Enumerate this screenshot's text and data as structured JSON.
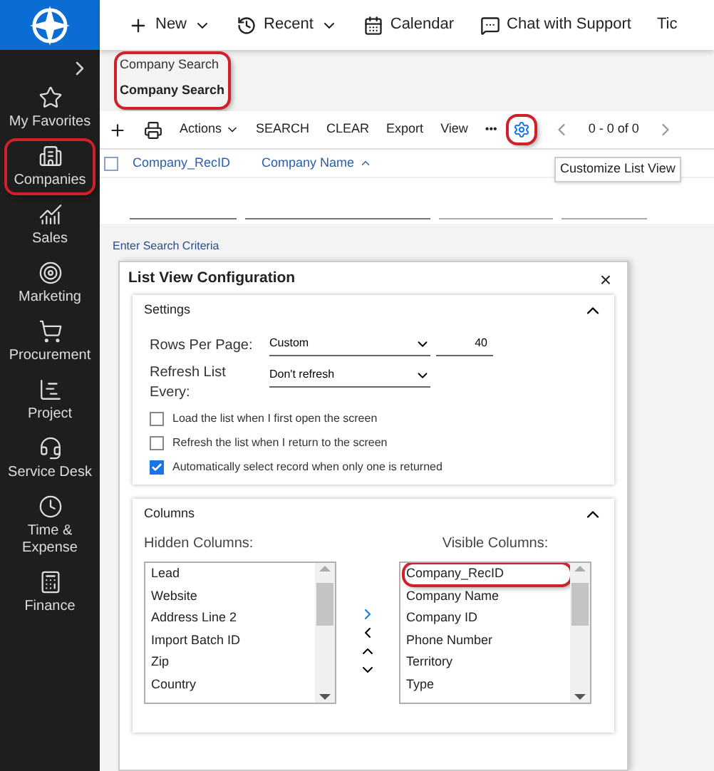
{
  "sidebar": {
    "items": [
      {
        "label": "My Favorites",
        "highlighted": false
      },
      {
        "label": "Companies",
        "highlighted": true
      },
      {
        "label": "Sales",
        "highlighted": false
      },
      {
        "label": "Marketing",
        "highlighted": false
      },
      {
        "label": "Procurement",
        "highlighted": false
      },
      {
        "label": "Project",
        "highlighted": false
      },
      {
        "label": "Service Desk",
        "highlighted": false
      },
      {
        "label": "Time & Expense",
        "highlighted": false
      },
      {
        "label": "Finance",
        "highlighted": false
      }
    ]
  },
  "top_menu": [
    {
      "label": "New",
      "dropdown": true
    },
    {
      "label": "Recent",
      "dropdown": true
    },
    {
      "label": "Calendar",
      "dropdown": false
    },
    {
      "label": "Chat with Support",
      "dropdown": false
    },
    {
      "label": "Tic",
      "dropdown": false
    }
  ],
  "breadcrumb": {
    "parent": "Company Search",
    "title": "Company Search",
    "highlighted": true
  },
  "toolbar": {
    "actions": "Actions",
    "buttons": [
      "SEARCH",
      "CLEAR",
      "Export",
      "View"
    ],
    "more": "•••",
    "settings_highlighted": true,
    "paging": "0 - 0 of 0",
    "tooltip": "Customize List View"
  },
  "table": {
    "select_all_checked": false,
    "columns": [
      {
        "label": "Company_RecID",
        "sorted": false
      },
      {
        "label": "Company Name",
        "sorted": true
      }
    ],
    "hint": "Enter Search Criteria"
  },
  "dialog": {
    "title": "List View Configuration",
    "close": "×",
    "settings": {
      "title": "Settings",
      "expanded": true,
      "rows_label": "Rows Per Page:",
      "rows_value": "Custom",
      "rows_count": "40",
      "refresh_label": "Refresh List Every:",
      "refresh_value": "Don't refresh",
      "options": [
        {
          "label": "Load the list when I first open the screen",
          "checked": false
        },
        {
          "label": "Refresh the list when I return to the screen",
          "checked": false
        },
        {
          "label": "Automatically select record when only one is returned",
          "checked": true
        }
      ]
    },
    "columns": {
      "title": "Columns",
      "expanded": true,
      "hidden_label": "Hidden Columns:",
      "visible_label": "Visible Columns:",
      "hidden": [
        {
          "label": "Lead",
          "highlighted": false
        },
        {
          "label": "Website",
          "highlighted": false
        },
        {
          "label": "Address Line 2",
          "highlighted": false
        },
        {
          "label": "Import Batch ID",
          "highlighted": false
        },
        {
          "label": "Zip",
          "highlighted": false
        },
        {
          "label": "Country",
          "highlighted": false
        }
      ],
      "visible": [
        {
          "label": "Company_RecID",
          "highlighted": true
        },
        {
          "label": "Company Name",
          "highlighted": false
        },
        {
          "label": "Company ID",
          "highlighted": false
        },
        {
          "label": "Phone Number",
          "highlighted": false
        },
        {
          "label": "Territory",
          "highlighted": false
        },
        {
          "label": "Type",
          "highlighted": false
        }
      ]
    }
  }
}
